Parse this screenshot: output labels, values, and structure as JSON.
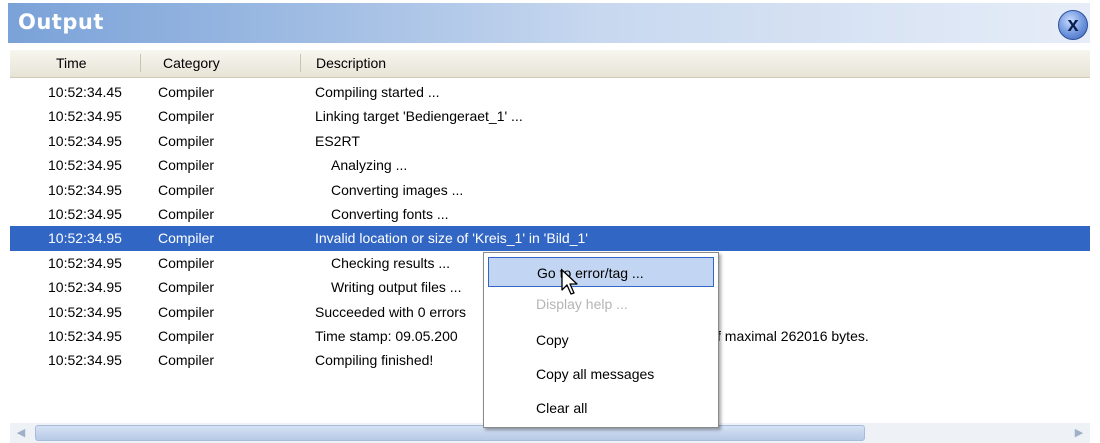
{
  "window": {
    "title": "Output",
    "close_glyph": "x"
  },
  "columns": {
    "time": "Time",
    "category": "Category",
    "description": "Description"
  },
  "rows": [
    {
      "time": "10:52:34.45",
      "category": "Compiler",
      "description": "Compiling started ...",
      "indent": 0
    },
    {
      "time": "10:52:34.95",
      "category": "Compiler",
      "description": "Linking target 'Bediengeraet_1' ...",
      "indent": 0
    },
    {
      "time": "10:52:34.95",
      "category": "Compiler",
      "description": "ES2RT",
      "indent": 0
    },
    {
      "time": "10:52:34.95",
      "category": "Compiler",
      "description": "Analyzing ...",
      "indent": 1
    },
    {
      "time": "10:52:34.95",
      "category": "Compiler",
      "description": "Converting images ...",
      "indent": 1
    },
    {
      "time": "10:52:34.95",
      "category": "Compiler",
      "description": "Converting fonts ...",
      "indent": 1
    },
    {
      "time": "10:52:34.95",
      "category": "Compiler",
      "description": "Invalid location or size of 'Kreis_1' in 'Bild_1'",
      "indent": 0,
      "selected": true
    },
    {
      "time": "10:52:34.95",
      "category": "Compiler",
      "description": "Checking results ...",
      "indent": 1
    },
    {
      "time": "10:52:34.95",
      "category": "Compiler",
      "description": "Writing output files ...",
      "indent": 1
    },
    {
      "time": "10:52:34.95",
      "category": "Compiler",
      "description": "Succeeded with 0 errors",
      "indent": 0
    },
    {
      "time": "10:52:34.95",
      "category": "Compiler",
      "description": "Time stamp: 09.05.200",
      "extra": "f maximal 262016 bytes.",
      "indent": 0
    },
    {
      "time": "10:52:34.95",
      "category": "Compiler",
      "description": "Compiling finished!",
      "indent": 0
    }
  ],
  "context_menu": [
    {
      "label": "Go to error/tag ...",
      "state": "highlight"
    },
    {
      "label": "Display help ...",
      "state": "disabled"
    },
    {
      "label": "Copy",
      "state": "normal"
    },
    {
      "label": "Copy all messages",
      "state": "normal"
    },
    {
      "label": "Clear all",
      "state": "normal"
    }
  ],
  "colors": {
    "selection": "#3166c4",
    "title_gradient_start": "#7aa2d8",
    "menu_highlight": "#c2d5f2"
  },
  "icons": {
    "close": "close-icon",
    "cursor": "mouse-pointer-icon",
    "scroll_left": "scroll-left-icon",
    "scroll_right": "scroll-right-icon"
  }
}
